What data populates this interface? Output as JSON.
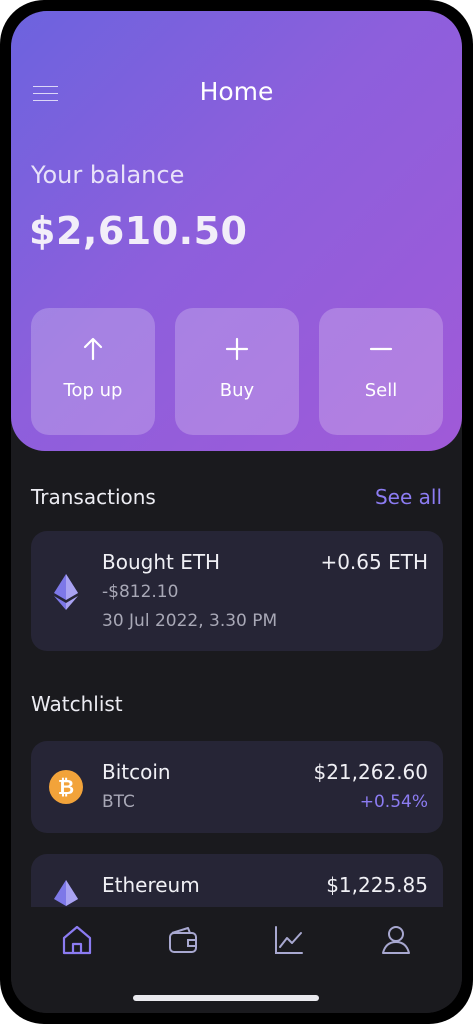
{
  "header": {
    "title": "Home"
  },
  "balance": {
    "label": "Your balance",
    "amount": "$2,610.50"
  },
  "actions": [
    {
      "label": "Top up",
      "icon": "arrow-up-icon"
    },
    {
      "label": "Buy",
      "icon": "plus-icon"
    },
    {
      "label": "Sell",
      "icon": "minus-icon"
    }
  ],
  "transactions": {
    "title": "Transactions",
    "see_all": "See all",
    "items": [
      {
        "title": "Bought ETH",
        "amount": "-$812.10",
        "date": "30 Jul 2022, 3.30 PM",
        "change": "+0.65 ETH",
        "icon": "ethereum-icon"
      }
    ]
  },
  "watchlist": {
    "title": "Watchlist",
    "items": [
      {
        "name": "Bitcoin",
        "symbol": "BTC",
        "price": "$21,262.60",
        "change": "+0.54%",
        "icon": "bitcoin-icon"
      },
      {
        "name": "Ethereum",
        "price": "$1,225.85",
        "icon": "ethereum-icon"
      }
    ]
  },
  "tabbar": {
    "items": [
      {
        "icon": "home-icon",
        "active": true
      },
      {
        "icon": "wallet-icon",
        "active": false
      },
      {
        "icon": "chart-icon",
        "active": false
      },
      {
        "icon": "profile-icon",
        "active": false
      }
    ]
  },
  "colors": {
    "accent": "#8c7cf2",
    "gradient_start": "#6c63de",
    "gradient_end": "#a05ad8",
    "background": "#1a1a1e",
    "card": "#262536",
    "bitcoin": "#f2a33a"
  }
}
